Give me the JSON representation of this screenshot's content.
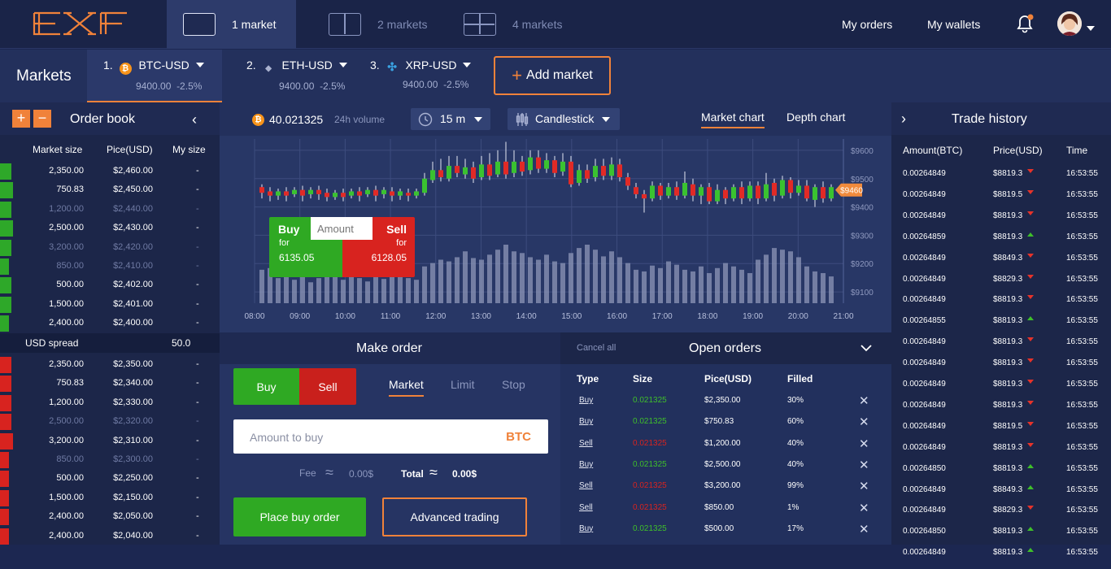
{
  "logo": {
    "text": "EXF"
  },
  "view_tabs": [
    {
      "label": "1 market"
    },
    {
      "label": "2 markets"
    },
    {
      "label": "4 markets"
    }
  ],
  "topnav": {
    "orders": "My orders",
    "wallets": "My wallets"
  },
  "markets_bar": {
    "title": "Markets",
    "add_label": "Add market",
    "items": [
      {
        "index": "1.",
        "pair": "BTC-USD",
        "price": "9400.00",
        "change": "-2.5%",
        "coin": "bitcoin-icon"
      },
      {
        "index": "2.",
        "pair": "ETH-USD",
        "price": "9400.00",
        "change": "-2.5%",
        "coin": "ethereum-icon"
      },
      {
        "index": "3.",
        "pair": "XRP-USD",
        "price": "9400.00",
        "change": "-2.5%",
        "coin": "ripple-icon"
      }
    ]
  },
  "order_book": {
    "title": "Order book",
    "headers": [
      "Market size",
      "Pice(USD)",
      "My size"
    ],
    "asks": [
      {
        "size": "2,350.00",
        "price": "$2,460.00",
        "my": "-",
        "depth": 0.05,
        "dim": false
      },
      {
        "size": "750.83",
        "price": "$2,450.00",
        "my": "-",
        "depth": 0.06,
        "dim": false
      },
      {
        "size": "1,200.00",
        "price": "$2,440.00",
        "my": "-",
        "depth": 0.05,
        "dim": true
      },
      {
        "size": "2,500.00",
        "price": "$2,430.00",
        "my": "-",
        "depth": 0.06,
        "dim": false
      },
      {
        "size": "3,200.00",
        "price": "$2,420.00",
        "my": "-",
        "depth": 0.05,
        "dim": true
      },
      {
        "size": "850.00",
        "price": "$2,410.00",
        "my": "-",
        "depth": 0.04,
        "dim": true
      },
      {
        "size": "500.00",
        "price": "$2,402.00",
        "my": "-",
        "depth": 0.05,
        "dim": false
      },
      {
        "size": "1,500.00",
        "price": "$2,401.00",
        "my": "-",
        "depth": 0.05,
        "dim": false
      },
      {
        "size": "2,400.00",
        "price": "$2,400.00",
        "my": "-",
        "depth": 0.04,
        "dim": false
      }
    ],
    "spread_label": "USD spread",
    "spread_value": "50.0",
    "bids": [
      {
        "size": "2,350.00",
        "price": "$2,350.00",
        "my": "-",
        "depth": 0.05,
        "dim": false
      },
      {
        "size": "750.83",
        "price": "$2,340.00",
        "my": "-",
        "depth": 0.05,
        "dim": false
      },
      {
        "size": "1,200.00",
        "price": "$2,330.00",
        "my": "-",
        "depth": 0.05,
        "dim": false
      },
      {
        "size": "2,500.00",
        "price": "$2,320.00",
        "my": "-",
        "depth": 0.05,
        "dim": true
      },
      {
        "size": "3,200.00",
        "price": "$2,310.00",
        "my": "-",
        "depth": 0.06,
        "dim": false
      },
      {
        "size": "850.00",
        "price": "$2,300.00",
        "my": "-",
        "depth": 0.04,
        "dim": true
      },
      {
        "size": "500.00",
        "price": "$2,250.00",
        "my": "-",
        "depth": 0.04,
        "dim": false
      },
      {
        "size": "1,500.00",
        "price": "$2,150.00",
        "my": "-",
        "depth": 0.04,
        "dim": false
      },
      {
        "size": "2,400.00",
        "price": "$2,050.00",
        "my": "-",
        "depth": 0.04,
        "dim": false
      },
      {
        "size": "2,400.00",
        "price": "$2,040.00",
        "my": "-",
        "depth": 0.04,
        "dim": false
      }
    ]
  },
  "chart_toolbar": {
    "volume": "40.021325",
    "volume_label": "24h volume",
    "interval": "15 m",
    "type": "Candlestick",
    "tab_market": "Market chart",
    "tab_depth": "Depth chart"
  },
  "quick_trade": {
    "buy_label": "Buy",
    "buy_for": "for",
    "buy_price": "6135.05",
    "sell_label": "Sell",
    "sell_for": "for",
    "sell_price": "6128.05",
    "amount_placeholder": "Amount"
  },
  "chart_data": {
    "type": "candlestick",
    "x_ticks": [
      "08:00",
      "09:00",
      "10:00",
      "11:00",
      "12:00",
      "13:00",
      "14:00",
      "15:00",
      "16:00",
      "17:00",
      "18:00",
      "19:00",
      "20:00",
      "21:00"
    ],
    "y_ticks": [
      "$9600",
      "$9500",
      "$9400",
      "$9300",
      "$9200",
      "$9100"
    ],
    "y_tick_values": [
      9600,
      9500,
      9400,
      9300,
      9200,
      9100
    ],
    "ylim": [
      9060,
      9640
    ],
    "current_price_label": "$9460",
    "current_price": 9460,
    "colors": {
      "up": "#3ac230",
      "down": "#e12a26",
      "volume": "#8d97b8",
      "price_tag": "#f08a3c"
    },
    "candles": [
      [
        9470,
        9450,
        9480,
        9430
      ],
      [
        9455,
        9440,
        9470,
        9420
      ],
      [
        9440,
        9455,
        9465,
        9425
      ],
      [
        9455,
        9440,
        9470,
        9420
      ],
      [
        9445,
        9460,
        9470,
        9435
      ],
      [
        9460,
        9440,
        9475,
        9420
      ],
      [
        9445,
        9460,
        9470,
        9430
      ],
      [
        9460,
        9445,
        9475,
        9425
      ],
      [
        9450,
        9435,
        9465,
        9420
      ],
      [
        9435,
        9450,
        9460,
        9425
      ],
      [
        9450,
        9435,
        9465,
        9420
      ],
      [
        9440,
        9455,
        9465,
        9430
      ],
      [
        9455,
        9440,
        9470,
        9420
      ],
      [
        9445,
        9460,
        9470,
        9435
      ],
      [
        9460,
        9440,
        9475,
        9420
      ],
      [
        9445,
        9460,
        9470,
        9430
      ],
      [
        9455,
        9440,
        9470,
        9420
      ],
      [
        9440,
        9455,
        9465,
        9425
      ],
      [
        9450,
        9440,
        9465,
        9420
      ],
      [
        9440,
        9455,
        9465,
        9430
      ],
      [
        9450,
        9500,
        9520,
        9440
      ],
      [
        9495,
        9530,
        9560,
        9485
      ],
      [
        9530,
        9505,
        9570,
        9490
      ],
      [
        9500,
        9545,
        9580,
        9490
      ],
      [
        9545,
        9520,
        9580,
        9505
      ],
      [
        9515,
        9540,
        9570,
        9500
      ],
      [
        9540,
        9500,
        9560,
        9485
      ],
      [
        9505,
        9550,
        9580,
        9495
      ],
      [
        9550,
        9510,
        9590,
        9495
      ],
      [
        9515,
        9560,
        9600,
        9505
      ],
      [
        9560,
        9515,
        9630,
        9500
      ],
      [
        9520,
        9560,
        9600,
        9505
      ],
      [
        9560,
        9525,
        9580,
        9510
      ],
      [
        9530,
        9575,
        9600,
        9515
      ],
      [
        9575,
        9535,
        9600,
        9520
      ],
      [
        9535,
        9565,
        9590,
        9520
      ],
      [
        9565,
        9520,
        9580,
        9505
      ],
      [
        9525,
        9560,
        9590,
        9510
      ],
      [
        9560,
        9480,
        9580,
        9470
      ],
      [
        9485,
        9530,
        9550,
        9475
      ],
      [
        9530,
        9500,
        9550,
        9485
      ],
      [
        9505,
        9545,
        9570,
        9490
      ],
      [
        9545,
        9510,
        9570,
        9495
      ],
      [
        9510,
        9550,
        9575,
        9495
      ],
      [
        9550,
        9505,
        9570,
        9490
      ],
      [
        9505,
        9475,
        9520,
        9460
      ],
      [
        9470,
        9445,
        9485,
        9430
      ],
      [
        9445,
        9430,
        9460,
        9380
      ],
      [
        9430,
        9475,
        9490,
        9420
      ],
      [
        9475,
        9440,
        9485,
        9425
      ],
      [
        9440,
        9470,
        9485,
        9430
      ],
      [
        9470,
        9440,
        9490,
        9425
      ],
      [
        9440,
        9485,
        9525,
        9430
      ],
      [
        9480,
        9440,
        9500,
        9420
      ],
      [
        9440,
        9470,
        9480,
        9410
      ],
      [
        9470,
        9420,
        9485,
        9410
      ],
      [
        9420,
        9460,
        9480,
        9410
      ],
      [
        9460,
        9430,
        9470,
        9410
      ],
      [
        9430,
        9470,
        9480,
        9420
      ],
      [
        9470,
        9430,
        9490,
        9410
      ],
      [
        9430,
        9475,
        9490,
        9420
      ],
      [
        9475,
        9430,
        9490,
        9410
      ],
      [
        9430,
        9480,
        9520,
        9420
      ],
      [
        9485,
        9440,
        9500,
        9420
      ],
      [
        9440,
        9495,
        9510,
        9430
      ],
      [
        9495,
        9450,
        9505,
        9430
      ],
      [
        9450,
        9475,
        9495,
        9440
      ],
      [
        9475,
        9430,
        9495,
        9420
      ],
      [
        9425,
        9470,
        9480,
        9400
      ],
      [
        9470,
        9430,
        9490,
        9415
      ],
      [
        9430,
        9470,
        9480,
        9420
      ]
    ],
    "volume": [
      40,
      42,
      30,
      36,
      28,
      32,
      25,
      30,
      38,
      34,
      28,
      33,
      30,
      26,
      34,
      29,
      32,
      35,
      30,
      28,
      44,
      48,
      52,
      50,
      55,
      62,
      54,
      52,
      58,
      64,
      70,
      62,
      60,
      55,
      52,
      58,
      50,
      48,
      60,
      66,
      70,
      64,
      56,
      62,
      55,
      48,
      40,
      38,
      45,
      42,
      50,
      46,
      40,
      38,
      44,
      36,
      42,
      48,
      44,
      40,
      36,
      52,
      58,
      66,
      64,
      62,
      55,
      44,
      38,
      36,
      32
    ]
  },
  "make_order": {
    "title": "Make order",
    "buy": "Buy",
    "sell": "Sell",
    "tabs": [
      "Market",
      "Limit",
      "Stop"
    ],
    "amount_placeholder": "Amount to buy",
    "currency": "BTC",
    "fee_label": "Fee",
    "fee_value": "0.00$",
    "total_label": "Total",
    "total_value": "0.00$",
    "approx": "≈",
    "place_label": "Place buy order",
    "advanced_label": "Advanced trading"
  },
  "open_orders": {
    "title": "Open orders",
    "cancel_all": "Cancel all",
    "headers": [
      "Type",
      "Size",
      "Pice(USD)",
      "Filled"
    ],
    "rows": [
      {
        "type": "Buy",
        "size": "0.021325",
        "price": "$2,350.00",
        "filled": "30%",
        "side": "buy"
      },
      {
        "type": "Buy",
        "size": "0.021325",
        "price": "$750.83",
        "filled": "60%",
        "side": "buy"
      },
      {
        "type": "Sell",
        "size": "0.021325",
        "price": "$1,200.00",
        "filled": "40%",
        "side": "sell"
      },
      {
        "type": "Buy",
        "size": "0.021325",
        "price": "$2,500.00",
        "filled": "40%",
        "side": "buy"
      },
      {
        "type": "Sell",
        "size": "0.021325",
        "price": "$3,200.00",
        "filled": "99%",
        "side": "sell"
      },
      {
        "type": "Sell",
        "size": "0.021325",
        "price": "$850.00",
        "filled": "1%",
        "side": "sell"
      },
      {
        "type": "Buy",
        "size": "0.021325",
        "price": "$500.00",
        "filled": "17%",
        "side": "buy"
      }
    ]
  },
  "trade_history": {
    "title": "Trade history",
    "headers": [
      "Amount(BTC)",
      "Price(USD)",
      "Time"
    ],
    "rows": [
      {
        "amount": "0.00264849",
        "price": "$8819.3",
        "dir": "down",
        "time": "16:53:55"
      },
      {
        "amount": "0.00264849",
        "price": "$8819.5",
        "dir": "down",
        "time": "16:53:55"
      },
      {
        "amount": "0.00264849",
        "price": "$8819.3",
        "dir": "down",
        "time": "16:53:55"
      },
      {
        "amount": "0.00264859",
        "price": "$8819.3",
        "dir": "up",
        "time": "16:53:55"
      },
      {
        "amount": "0.00264849",
        "price": "$8849.3",
        "dir": "down",
        "time": "16:53:55"
      },
      {
        "amount": "0.00264849",
        "price": "$8829.3",
        "dir": "down",
        "time": "16:53:55"
      },
      {
        "amount": "0.00264849",
        "price": "$8819.3",
        "dir": "down",
        "time": "16:53:55"
      },
      {
        "amount": "0.00264855",
        "price": "$8819.3",
        "dir": "up",
        "time": "16:53:55"
      },
      {
        "amount": "0.00264849",
        "price": "$8819.3",
        "dir": "down",
        "time": "16:53:55"
      },
      {
        "amount": "0.00264849",
        "price": "$8819.3",
        "dir": "down",
        "time": "16:53:55"
      },
      {
        "amount": "0.00264849",
        "price": "$8819.3",
        "dir": "down",
        "time": "16:53:55"
      },
      {
        "amount": "0.00264849",
        "price": "$8819.3",
        "dir": "down",
        "time": "16:53:55"
      },
      {
        "amount": "0.00264849",
        "price": "$8819.5",
        "dir": "down",
        "time": "16:53:55"
      },
      {
        "amount": "0.00264849",
        "price": "$8819.3",
        "dir": "down",
        "time": "16:53:55"
      },
      {
        "amount": "0.00264850",
        "price": "$8819.3",
        "dir": "up",
        "time": "16:53:55"
      },
      {
        "amount": "0.00264849",
        "price": "$8849.3",
        "dir": "up",
        "time": "16:53:55"
      },
      {
        "amount": "0.00264849",
        "price": "$8829.3",
        "dir": "down",
        "time": "16:53:55"
      },
      {
        "amount": "0.00264850",
        "price": "$8819.3",
        "dir": "up",
        "time": "16:53:55"
      },
      {
        "amount": "0.00264849",
        "price": "$8819.3",
        "dir": "up",
        "time": "16:53:55"
      }
    ]
  }
}
